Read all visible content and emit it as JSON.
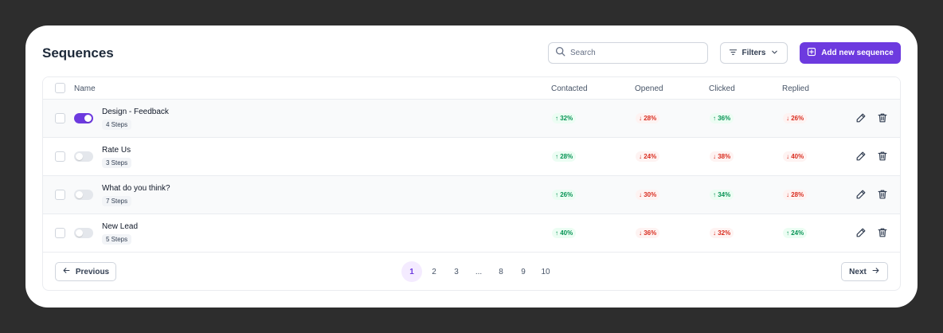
{
  "header": {
    "title": "Sequences",
    "search_placeholder": "Search",
    "filters_label": "Filters",
    "add_label": "Add new sequence"
  },
  "table": {
    "columns": {
      "name": "Name",
      "contacted": "Contacted",
      "opened": "Opened",
      "clicked": "Clicked",
      "replied": "Replied"
    },
    "rows": [
      {
        "name": "Design - Feedback",
        "steps": "4 Steps",
        "enabled": true,
        "contacted": {
          "value": "32%",
          "trend": "up"
        },
        "opened": {
          "value": "28%",
          "trend": "down"
        },
        "clicked": {
          "value": "36%",
          "trend": "up"
        },
        "replied": {
          "value": "26%",
          "trend": "down"
        }
      },
      {
        "name": "Rate Us",
        "steps": "3 Steps",
        "enabled": false,
        "contacted": {
          "value": "28%",
          "trend": "up"
        },
        "opened": {
          "value": "24%",
          "trend": "down"
        },
        "clicked": {
          "value": "38%",
          "trend": "down"
        },
        "replied": {
          "value": "40%",
          "trend": "down"
        }
      },
      {
        "name": "What do you think?",
        "steps": "7 Steps",
        "enabled": false,
        "contacted": {
          "value": "26%",
          "trend": "up"
        },
        "opened": {
          "value": "30%",
          "trend": "down"
        },
        "clicked": {
          "value": "34%",
          "trend": "up"
        },
        "replied": {
          "value": "28%",
          "trend": "down"
        }
      },
      {
        "name": "New Lead",
        "steps": "5 Steps",
        "enabled": false,
        "contacted": {
          "value": "40%",
          "trend": "up"
        },
        "opened": {
          "value": "36%",
          "trend": "down"
        },
        "clicked": {
          "value": "32%",
          "trend": "down"
        },
        "replied": {
          "value": "24%",
          "trend": "up"
        }
      }
    ]
  },
  "pagination": {
    "previous_label": "Previous",
    "next_label": "Next",
    "pages": [
      "1",
      "2",
      "3",
      "...",
      "8",
      "9",
      "10"
    ],
    "active_page": "1"
  },
  "colors": {
    "accent": "#6d3adf",
    "up": "#079455",
    "down": "#d92d20",
    "background": "#2d2d2d"
  }
}
